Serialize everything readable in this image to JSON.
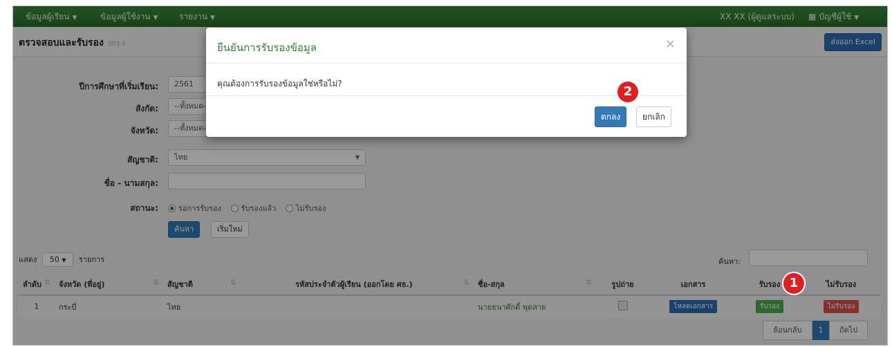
{
  "navbar": {
    "menu": [
      {
        "label": "ข้อมูลผู้เรียน"
      },
      {
        "label": "ข้อมูลผู้ใช้งาน"
      },
      {
        "label": "รายงาน"
      }
    ],
    "user": "XX XX (ผู้ดูแลระบบ)",
    "account": "บัญชีผู้ใช้"
  },
  "page": {
    "title": "ตรวจสอบและรับรอง",
    "subtitle": "S03-1",
    "export_button": "ส่งออก Excel"
  },
  "form": {
    "year_label": "ปีการศึกษาที่เริ่มเรียน:",
    "year_value": "2561",
    "affiliation_label": "สังกัด:",
    "affiliation_value": "--ทั้งหมด--",
    "province_label": "จังหวัด:",
    "province_value": "--ทั้งหมด--",
    "nationality_label": "สัญชาติ:",
    "nationality_value": "ไทย",
    "name_label": "ชื่อ - นามสกุล:",
    "name_value": "",
    "status_label": "สถานะ:",
    "status_options": [
      "รอการรับรอง",
      "รับรองแล้ว",
      "ไม่รับรอง"
    ],
    "search_button": "ค้นหา",
    "reset_button": "เริ่มใหม่"
  },
  "list_controls": {
    "show_label": "แสดง",
    "page_size": "50",
    "items_label": "รายการ",
    "search_label": "ค้นหา:"
  },
  "table": {
    "headers": [
      "ลำดับ",
      "จังหวัด (ที่อยู่)",
      "สัญชาติ",
      "รหัสประจำตัวผู้เรียน (ออกโดย ศธ.)",
      "ชื่อ-สกุล",
      "รูปถ่าย",
      "เอกสาร",
      "รับรอง",
      "ไม่รับรอง"
    ],
    "rows": [
      {
        "no": "1",
        "province": "กระบี่",
        "nationality": "ไทย",
        "student_id": "",
        "name": "นายธนาศักดิ์ พุดสาย",
        "doc_button": "โหลดเอกสาร",
        "approve_button": "รับรอง",
        "reject_button": "ไม่รับรอง"
      }
    ]
  },
  "pagination": {
    "prev": "ย้อนกลับ",
    "current": "1",
    "next": "ถัดไป"
  },
  "modal": {
    "title": "ยืนยันการรับรองข้อมูล",
    "close": "×",
    "message": "คุณต้องการรับรองข้อมูลใช่หรือไม่?",
    "ok_button": "ตกลง",
    "cancel_button": "ยกเลิก"
  },
  "callouts": {
    "step1": "1",
    "step2": "2"
  },
  "colors": {
    "navbar": "#2b6f2d",
    "primary": "#337ab7",
    "approve": "#4cae4c",
    "reject": "#d9534f",
    "callout": "#e02020"
  }
}
